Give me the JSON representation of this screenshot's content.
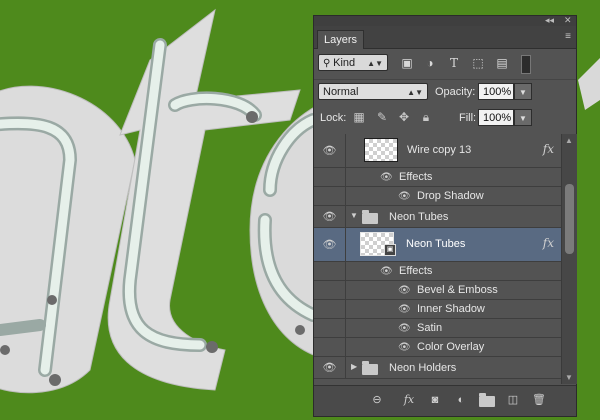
{
  "panel": {
    "tab_label": "Layers",
    "titlebar_collapse": "◂◂",
    "titlebar_close": "✕",
    "menu_icon": "≡"
  },
  "filter": {
    "kind_label": "Kind",
    "icons": [
      "image-filter-icon",
      "adjustment-filter-icon",
      "type-filter-icon",
      "shape-filter-icon",
      "smart-object-filter-icon"
    ]
  },
  "blend": {
    "mode": "Normal",
    "opacity_label": "Opacity:",
    "opacity_value": "100%",
    "lock_label": "Lock:",
    "fill_label": "Fill:",
    "fill_value": "100%"
  },
  "layers": [
    {
      "type": "layer",
      "name": "Wire copy 13",
      "fx": "fx"
    },
    {
      "type": "effects",
      "name": "Effects"
    },
    {
      "type": "effect",
      "name": "Drop Shadow"
    },
    {
      "type": "group",
      "name": "Neon Tubes",
      "expanded": true
    },
    {
      "type": "layer",
      "name": "Neon Tubes",
      "fx": "fx",
      "selected": true
    },
    {
      "type": "effects",
      "name": "Effects"
    },
    {
      "type": "effect",
      "name": "Bevel & Emboss"
    },
    {
      "type": "effect",
      "name": "Inner Shadow"
    },
    {
      "type": "effect",
      "name": "Satin"
    },
    {
      "type": "effect",
      "name": "Color Overlay"
    },
    {
      "type": "group",
      "name": "Neon Holders",
      "expanded": false
    }
  ],
  "footer": {
    "link_icon": "⊖",
    "fx_icon": "fx",
    "mask_icon": "◙",
    "adjustment_icon": "◐",
    "group_icon": "folder",
    "new_layer_icon": "new-layer",
    "delete_icon": "trash"
  },
  "colors": {
    "background": "#4e8a1c",
    "panel": "#535353",
    "selected_row": "#596a82"
  }
}
